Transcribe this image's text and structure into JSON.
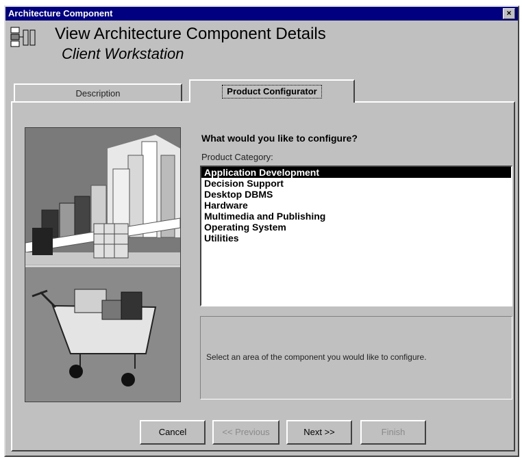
{
  "window": {
    "title": "Architecture Component",
    "close_glyph": "×"
  },
  "header": {
    "title": "View Architecture Component Details",
    "subtitle": "Client Workstation",
    "icon": "component-icon"
  },
  "tabs": [
    {
      "label": "Description",
      "active": false
    },
    {
      "label": "Product Configurator",
      "active": true
    }
  ],
  "configurator": {
    "question": "What would you like to configure?",
    "category_label": "Product Category:",
    "categories": [
      "Application Development",
      "Decision Support",
      "Desktop DBMS",
      "Hardware",
      "Multimedia and Publishing",
      "Operating System",
      "Utilities"
    ],
    "selected_index": 0,
    "info_text": "Select an area of the component you would like to configure."
  },
  "buttons": {
    "cancel": "Cancel",
    "previous": "<< Previous",
    "next": "Next >>",
    "finish": "Finish"
  }
}
